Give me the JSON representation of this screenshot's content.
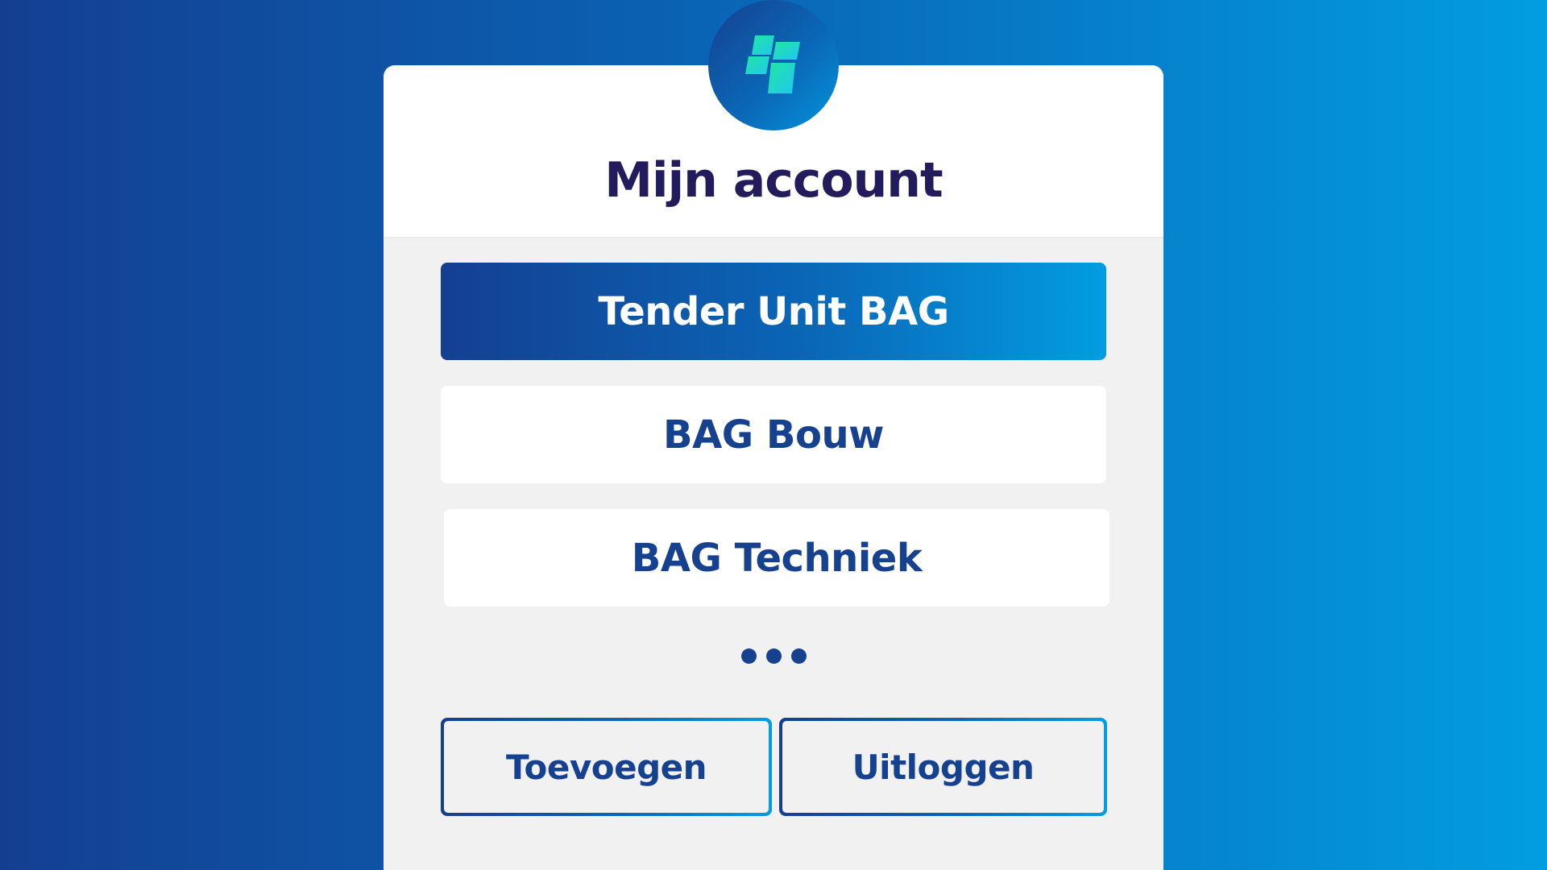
{
  "panel": {
    "title": "Mijn account"
  },
  "logo": {
    "icon": "grid-logo-icon"
  },
  "accounts": [
    {
      "label": "Tender Unit BAG",
      "active": true
    },
    {
      "label": "BAG Bouw",
      "active": false
    },
    {
      "label": "BAG Techniek",
      "active": false
    }
  ],
  "more_indicator": "more-dots-icon",
  "actions": {
    "add_label": "Toevoegen",
    "logout_label": "Uitloggen"
  },
  "colors": {
    "brand_dark": "#143f91",
    "brand_light": "#029de1",
    "title_text": "#221b5c",
    "item_text": "#15418f",
    "logo_green": "#22e6a0",
    "logo_cyan": "#1ec8f0"
  }
}
